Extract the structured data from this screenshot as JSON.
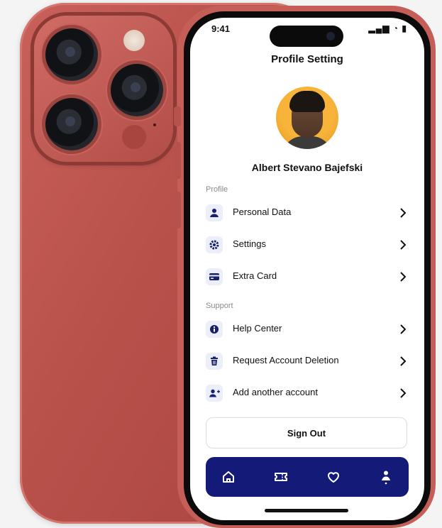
{
  "status_bar": {
    "time": "9:41",
    "icons": "▂▄▆ ◔ ▮"
  },
  "header": {
    "title": "Profile Setting"
  },
  "user": {
    "name": "Albert Stevano Bajefski"
  },
  "sections": {
    "profile": {
      "label": "Profile",
      "items": [
        {
          "label": "Personal Data",
          "icon": "person-icon"
        },
        {
          "label": "Settings",
          "icon": "gear-icon"
        },
        {
          "label": "Extra Card",
          "icon": "card-icon"
        }
      ]
    },
    "support": {
      "label": "Support",
      "items": [
        {
          "label": "Help Center",
          "icon": "info-icon"
        },
        {
          "label": "Request Account Deletion",
          "icon": "trash-icon"
        },
        {
          "label": "Add another account",
          "icon": "add-user-icon"
        }
      ]
    }
  },
  "actions": {
    "sign_out": "Sign Out"
  },
  "bottom_nav": {
    "items": [
      "home-icon",
      "ticket-icon",
      "heart-icon",
      "profile-icon"
    ],
    "active": "profile-icon"
  },
  "colors": {
    "accent": "#131a78",
    "icon_bg": "#eceef9",
    "phone_body": "#b9514b"
  }
}
